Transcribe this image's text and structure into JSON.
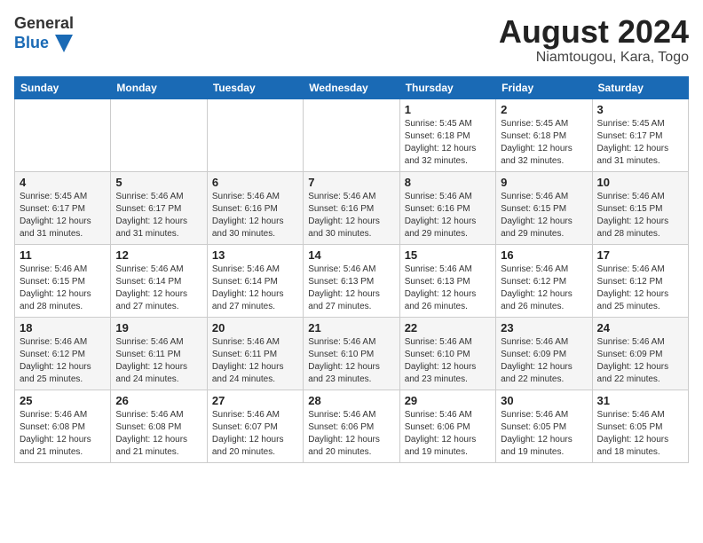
{
  "logo": {
    "text_general": "General",
    "text_blue": "Blue"
  },
  "title": "August 2024",
  "subtitle": "Niamtougou, Kara, Togo",
  "days_of_week": [
    "Sunday",
    "Monday",
    "Tuesday",
    "Wednesday",
    "Thursday",
    "Friday",
    "Saturday"
  ],
  "weeks": [
    [
      {
        "day": "",
        "info": ""
      },
      {
        "day": "",
        "info": ""
      },
      {
        "day": "",
        "info": ""
      },
      {
        "day": "",
        "info": ""
      },
      {
        "day": "1",
        "info": "Sunrise: 5:45 AM\nSunset: 6:18 PM\nDaylight: 12 hours\nand 32 minutes."
      },
      {
        "day": "2",
        "info": "Sunrise: 5:45 AM\nSunset: 6:18 PM\nDaylight: 12 hours\nand 32 minutes."
      },
      {
        "day": "3",
        "info": "Sunrise: 5:45 AM\nSunset: 6:17 PM\nDaylight: 12 hours\nand 31 minutes."
      }
    ],
    [
      {
        "day": "4",
        "info": "Sunrise: 5:45 AM\nSunset: 6:17 PM\nDaylight: 12 hours\nand 31 minutes."
      },
      {
        "day": "5",
        "info": "Sunrise: 5:46 AM\nSunset: 6:17 PM\nDaylight: 12 hours\nand 31 minutes."
      },
      {
        "day": "6",
        "info": "Sunrise: 5:46 AM\nSunset: 6:16 PM\nDaylight: 12 hours\nand 30 minutes."
      },
      {
        "day": "7",
        "info": "Sunrise: 5:46 AM\nSunset: 6:16 PM\nDaylight: 12 hours\nand 30 minutes."
      },
      {
        "day": "8",
        "info": "Sunrise: 5:46 AM\nSunset: 6:16 PM\nDaylight: 12 hours\nand 29 minutes."
      },
      {
        "day": "9",
        "info": "Sunrise: 5:46 AM\nSunset: 6:15 PM\nDaylight: 12 hours\nand 29 minutes."
      },
      {
        "day": "10",
        "info": "Sunrise: 5:46 AM\nSunset: 6:15 PM\nDaylight: 12 hours\nand 28 minutes."
      }
    ],
    [
      {
        "day": "11",
        "info": "Sunrise: 5:46 AM\nSunset: 6:15 PM\nDaylight: 12 hours\nand 28 minutes."
      },
      {
        "day": "12",
        "info": "Sunrise: 5:46 AM\nSunset: 6:14 PM\nDaylight: 12 hours\nand 27 minutes."
      },
      {
        "day": "13",
        "info": "Sunrise: 5:46 AM\nSunset: 6:14 PM\nDaylight: 12 hours\nand 27 minutes."
      },
      {
        "day": "14",
        "info": "Sunrise: 5:46 AM\nSunset: 6:13 PM\nDaylight: 12 hours\nand 27 minutes."
      },
      {
        "day": "15",
        "info": "Sunrise: 5:46 AM\nSunset: 6:13 PM\nDaylight: 12 hours\nand 26 minutes."
      },
      {
        "day": "16",
        "info": "Sunrise: 5:46 AM\nSunset: 6:12 PM\nDaylight: 12 hours\nand 26 minutes."
      },
      {
        "day": "17",
        "info": "Sunrise: 5:46 AM\nSunset: 6:12 PM\nDaylight: 12 hours\nand 25 minutes."
      }
    ],
    [
      {
        "day": "18",
        "info": "Sunrise: 5:46 AM\nSunset: 6:12 PM\nDaylight: 12 hours\nand 25 minutes."
      },
      {
        "day": "19",
        "info": "Sunrise: 5:46 AM\nSunset: 6:11 PM\nDaylight: 12 hours\nand 24 minutes."
      },
      {
        "day": "20",
        "info": "Sunrise: 5:46 AM\nSunset: 6:11 PM\nDaylight: 12 hours\nand 24 minutes."
      },
      {
        "day": "21",
        "info": "Sunrise: 5:46 AM\nSunset: 6:10 PM\nDaylight: 12 hours\nand 23 minutes."
      },
      {
        "day": "22",
        "info": "Sunrise: 5:46 AM\nSunset: 6:10 PM\nDaylight: 12 hours\nand 23 minutes."
      },
      {
        "day": "23",
        "info": "Sunrise: 5:46 AM\nSunset: 6:09 PM\nDaylight: 12 hours\nand 22 minutes."
      },
      {
        "day": "24",
        "info": "Sunrise: 5:46 AM\nSunset: 6:09 PM\nDaylight: 12 hours\nand 22 minutes."
      }
    ],
    [
      {
        "day": "25",
        "info": "Sunrise: 5:46 AM\nSunset: 6:08 PM\nDaylight: 12 hours\nand 21 minutes."
      },
      {
        "day": "26",
        "info": "Sunrise: 5:46 AM\nSunset: 6:08 PM\nDaylight: 12 hours\nand 21 minutes."
      },
      {
        "day": "27",
        "info": "Sunrise: 5:46 AM\nSunset: 6:07 PM\nDaylight: 12 hours\nand 20 minutes."
      },
      {
        "day": "28",
        "info": "Sunrise: 5:46 AM\nSunset: 6:06 PM\nDaylight: 12 hours\nand 20 minutes."
      },
      {
        "day": "29",
        "info": "Sunrise: 5:46 AM\nSunset: 6:06 PM\nDaylight: 12 hours\nand 19 minutes."
      },
      {
        "day": "30",
        "info": "Sunrise: 5:46 AM\nSunset: 6:05 PM\nDaylight: 12 hours\nand 19 minutes."
      },
      {
        "day": "31",
        "info": "Sunrise: 5:46 AM\nSunset: 6:05 PM\nDaylight: 12 hours\nand 18 minutes."
      }
    ]
  ]
}
